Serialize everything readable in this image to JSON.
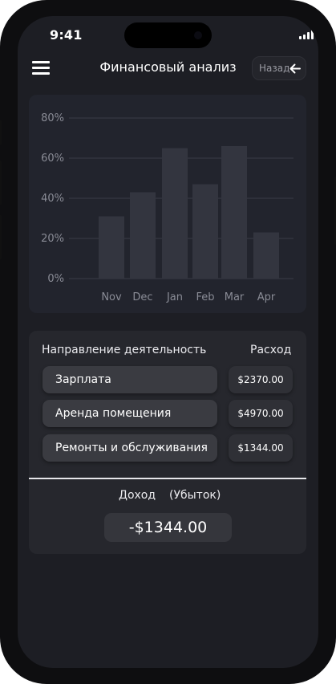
{
  "status_bar": {
    "time": "9:41"
  },
  "header": {
    "title": "Финансовый анализ",
    "back_label": "Назад",
    "menu_icon": "hamburger-menu-icon",
    "back_icon": "arrow-left-icon"
  },
  "colors": {
    "screen_bg": "#1d1e24",
    "chart_card_bg": "#22242d",
    "bar_fill": "#33353f",
    "gridline": "#3a3c47",
    "table_card_bg": "#26272d"
  },
  "chart_data": {
    "type": "bar",
    "categories": [
      "Nov",
      "Dec",
      "Jan",
      "Feb",
      "Mar",
      "Apr"
    ],
    "values": [
      31,
      43,
      65,
      47,
      66,
      23
    ],
    "title": "",
    "xlabel": "",
    "ylabel": "",
    "ylim": [
      0,
      80
    ],
    "yticks": [
      "0%",
      "20%",
      "40%",
      "60%",
      "80%"
    ],
    "grid": true,
    "legend": "none"
  },
  "table": {
    "col_activity": "Направление деятельность",
    "col_expense": "Расход",
    "rows": [
      {
        "name": "Зарплата",
        "value": "$2370.00"
      },
      {
        "name": "Аренда помещения",
        "value": "$4970.00"
      },
      {
        "name": "Ремонты и обслуживания",
        "value": "$1344.00"
      }
    ],
    "income_label": "Доход",
    "loss_label": "(Убыток)",
    "total": "-$1344.00"
  }
}
